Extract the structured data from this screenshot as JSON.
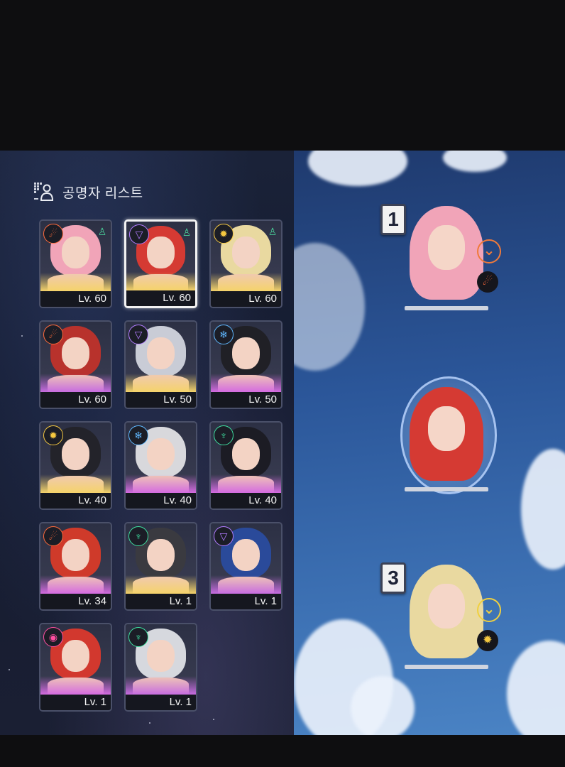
{
  "list_title": "공명자 리스트",
  "roster": [
    {
      "level": "Lv. 60",
      "element": "fire-icon",
      "element_glyph": "☄",
      "element_color": "#ff6a3a",
      "role": true,
      "hair": "#f1a4b8",
      "glow": "#f5d36a",
      "selected": false
    },
    {
      "level": "Lv. 60",
      "element": "void-icon",
      "element_glyph": "▽",
      "element_color": "#b27cff",
      "role": true,
      "hair": "#d53a33",
      "glow": "#f5d36a",
      "selected": true
    },
    {
      "level": "Lv. 60",
      "element": "light-icon",
      "element_glyph": "✹",
      "element_color": "#f5c840",
      "role": true,
      "hair": "#e9d9a0",
      "glow": "#f5d36a",
      "selected": false
    },
    {
      "level": "Lv. 60",
      "element": "fire-icon",
      "element_glyph": "☄",
      "element_color": "#ff6a3a",
      "role": false,
      "hair": "#b8322c",
      "glow": "#c76ce0",
      "selected": false
    },
    {
      "level": "Lv. 50",
      "element": "void-icon",
      "element_glyph": "▽",
      "element_color": "#b27cff",
      "role": false,
      "hair": "#c9ccd6",
      "glow": "#f5d36a",
      "selected": false
    },
    {
      "level": "Lv. 50",
      "element": "ice-icon",
      "element_glyph": "❄",
      "element_color": "#5fb8ff",
      "role": false,
      "hair": "#202026",
      "glow": "#d46be0",
      "selected": false
    },
    {
      "level": "Lv. 40",
      "element": "light-icon",
      "element_glyph": "✹",
      "element_color": "#f5c840",
      "role": false,
      "hair": "#23232a",
      "glow": "#f5d36a",
      "selected": false
    },
    {
      "level": "Lv. 40",
      "element": "ice-icon",
      "element_glyph": "❄",
      "element_color": "#5fb8ff",
      "role": false,
      "hair": "#d8d8dc",
      "glow": "#d46be0",
      "selected": false
    },
    {
      "level": "Lv. 40",
      "element": "wind-icon",
      "element_glyph": "♆",
      "element_color": "#3ee0a0",
      "role": false,
      "hair": "#1c1c24",
      "glow": "#d46be0",
      "selected": false
    },
    {
      "level": "Lv. 34",
      "element": "fire-icon",
      "element_glyph": "☄",
      "element_color": "#ff6a3a",
      "role": false,
      "hair": "#cf3a2a",
      "glow": "#d46be0",
      "selected": false
    },
    {
      "level": "Lv. 1",
      "element": "wind-icon",
      "element_glyph": "♆",
      "element_color": "#3ee0a0",
      "role": false,
      "hair": "#3a3a40",
      "glow": "#f5d36a",
      "selected": false
    },
    {
      "level": "Lv. 1",
      "element": "void-icon",
      "element_glyph": "▽",
      "element_color": "#b27cff",
      "role": false,
      "hair": "#2a4a9a",
      "glow": "#c76ce0",
      "selected": false
    },
    {
      "level": "Lv. 1",
      "element": "chaos-icon",
      "element_glyph": "◉",
      "element_color": "#ff4fa0",
      "role": false,
      "hair": "#d2382e",
      "glow": "#d46be0",
      "selected": false
    },
    {
      "level": "Lv. 1",
      "element": "wind-icon",
      "element_glyph": "♆",
      "element_color": "#3ee0a0",
      "role": false,
      "hair": "#d6d8de",
      "glow": "#c76ce0",
      "selected": false
    }
  ],
  "party": [
    {
      "slot": "1",
      "hair": "#f1a4b8",
      "badge_color": "#f07a3a",
      "element": "fire-icon",
      "element_glyph": "☄",
      "element_color": "#ff6a3a"
    },
    {
      "slot": "",
      "hair": "#d53a33"
    },
    {
      "slot": "3",
      "hair": "#e9d9a0",
      "badge_color": "#f0d040",
      "element": "light-icon",
      "element_glyph": "✹",
      "element_color": "#f5c840"
    }
  ],
  "colors": {
    "panel_left": "#1a2238",
    "sky": "#2b5699",
    "level_bar": "#15171f"
  }
}
